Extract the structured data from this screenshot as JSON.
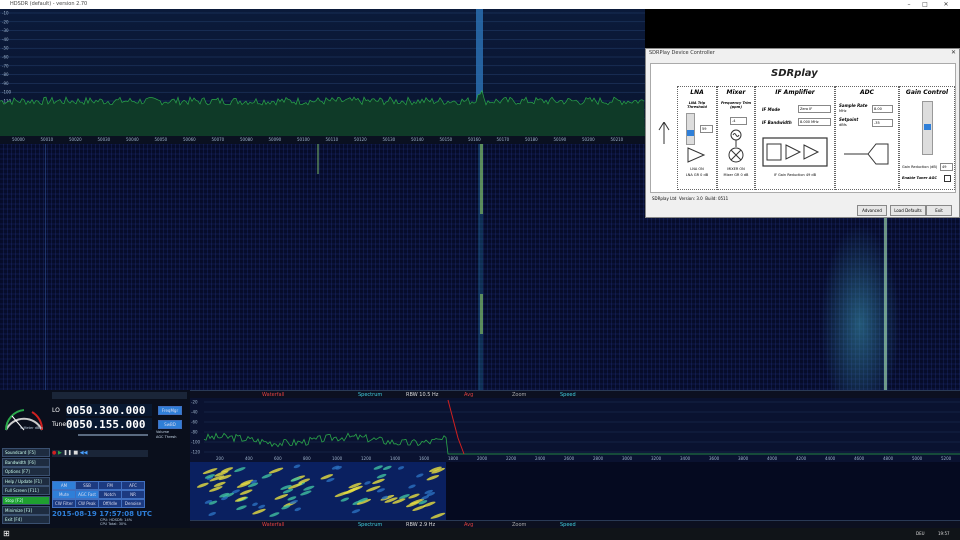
{
  "window": {
    "title": "HDSDR (default) - version 2.70"
  },
  "spectrum": {
    "db_labels": [
      "-10",
      "-20",
      "-30",
      "-40",
      "-50",
      "-60",
      "-70",
      "-80",
      "-90",
      "-100",
      "-110",
      "-120",
      "-130",
      "-140"
    ],
    "freq_labels": [
      "50000",
      "50010",
      "50020",
      "50030",
      "50040",
      "50050",
      "50060",
      "50070",
      "50080",
      "50090",
      "50100",
      "50110",
      "50120",
      "50130",
      "50140",
      "50150",
      "50160",
      "50170",
      "50180",
      "50190",
      "50200",
      "50210"
    ]
  },
  "sdrplay": {
    "title": "SDRPlay Device Controller",
    "logo": "SDRplay",
    "lna": {
      "title": "LNA",
      "threshold_label": "LNA Trip Threshold",
      "threshold_value": "59",
      "status1": "LNA ON",
      "status2": "LNA GR 0 dB"
    },
    "mixer": {
      "title": "Mixer",
      "freq_trim_label": "Frequency Trim (ppm)",
      "freq_trim_value": "-4",
      "status1": "MIXER ON",
      "status2": "Mixer GR 0 dB"
    },
    "if": {
      "title": "IF Amplifier",
      "mode_label": "IF Mode",
      "mode_value": "Zero IF",
      "bw_label": "IF Bandwidth",
      "bw_value": "8.000 MHz",
      "reduction": "IF Gain Reduction 49 dB"
    },
    "adc": {
      "title": "ADC",
      "rate_label": "Sample Rate",
      "rate_unit": "MHz",
      "rate_value": "8.00",
      "setpoint_label": "Setpoint",
      "setpoint_unit": "dBfs",
      "setpoint_value": "-35"
    },
    "gain": {
      "title": "Gain Control",
      "reduction_label": "Gain Reduction (dB)",
      "reduction_value": "49",
      "agc_label": "Enable Tuner AGC"
    },
    "footer": {
      "company": "SDRplay Ltd",
      "version": "Version: 3.0",
      "build": "Build: 0511"
    },
    "buttons": {
      "advanced": "Advanced",
      "load_defaults": "Load Defaults",
      "exit": "Exit"
    }
  },
  "controls": {
    "lo_label": "LO",
    "lo_value": "0050.300.000",
    "tune_label": "Tune",
    "tune_value": "0050.155.000",
    "freq_mgr": "FreqMgr",
    "sw_btn": "SwBD",
    "volume": "Volume",
    "agc_thresh": "AGC Thresh",
    "meter_label": "S-Meter dBm",
    "side_buttons": [
      "Soundcard [F5]",
      "Bandwidth [F6]",
      "Options [F7]",
      "Help / Update [F1]",
      "Full Screen [F11]",
      "Stop [F2]",
      "Minimize [F3]",
      "Exit [F4]"
    ],
    "modes_row1": [
      "AM",
      "SSB",
      "FM",
      "AFC"
    ],
    "modes_row2": [
      "Mute",
      "AGC Fast",
      "Notch",
      "NR"
    ],
    "modes_row3": [
      "CW Filter",
      "CW Peak",
      "Off/Idle",
      "Denoise"
    ],
    "datetime": "2015-08-19  17:57:08 UTC",
    "cpu": "CPU: HDSDR: 14%",
    "cpu_total": "CPU Total: 30%"
  },
  "audio": {
    "top_bar": {
      "waterfall": "Waterfall",
      "spectrum": "Spectrum",
      "rbw": "RBW 10.5 Hz",
      "avg": "Avg",
      "zoom": "Zoom",
      "speed": "Speed"
    },
    "bottom_bar": {
      "waterfall": "Waterfall",
      "spectrum": "Spectrum",
      "rbw": "RBW 2.9 Hz",
      "avg": "Avg",
      "zoom": "Zoom",
      "speed": "Speed"
    },
    "db_labels": [
      "-20",
      "-40",
      "-60",
      "-80",
      "-100",
      "-120"
    ],
    "freq_labels": [
      "200",
      "400",
      "600",
      "800",
      "1000",
      "1200",
      "1400",
      "1600",
      "1800",
      "2000",
      "2200",
      "2400",
      "2600",
      "2800",
      "3000",
      "3200",
      "3400",
      "3600",
      "3800",
      "4000",
      "4200",
      "4400",
      "4600",
      "4800",
      "5000",
      "5200"
    ]
  },
  "taskbar": {
    "time": "19:57",
    "lang": "DEU"
  },
  "colors": {
    "spectrum_trace": "#2aa84a",
    "dialog_bg": "#f0f0f0",
    "lcd_bg": "#081830",
    "accent_blue": "#2f7fd8"
  }
}
